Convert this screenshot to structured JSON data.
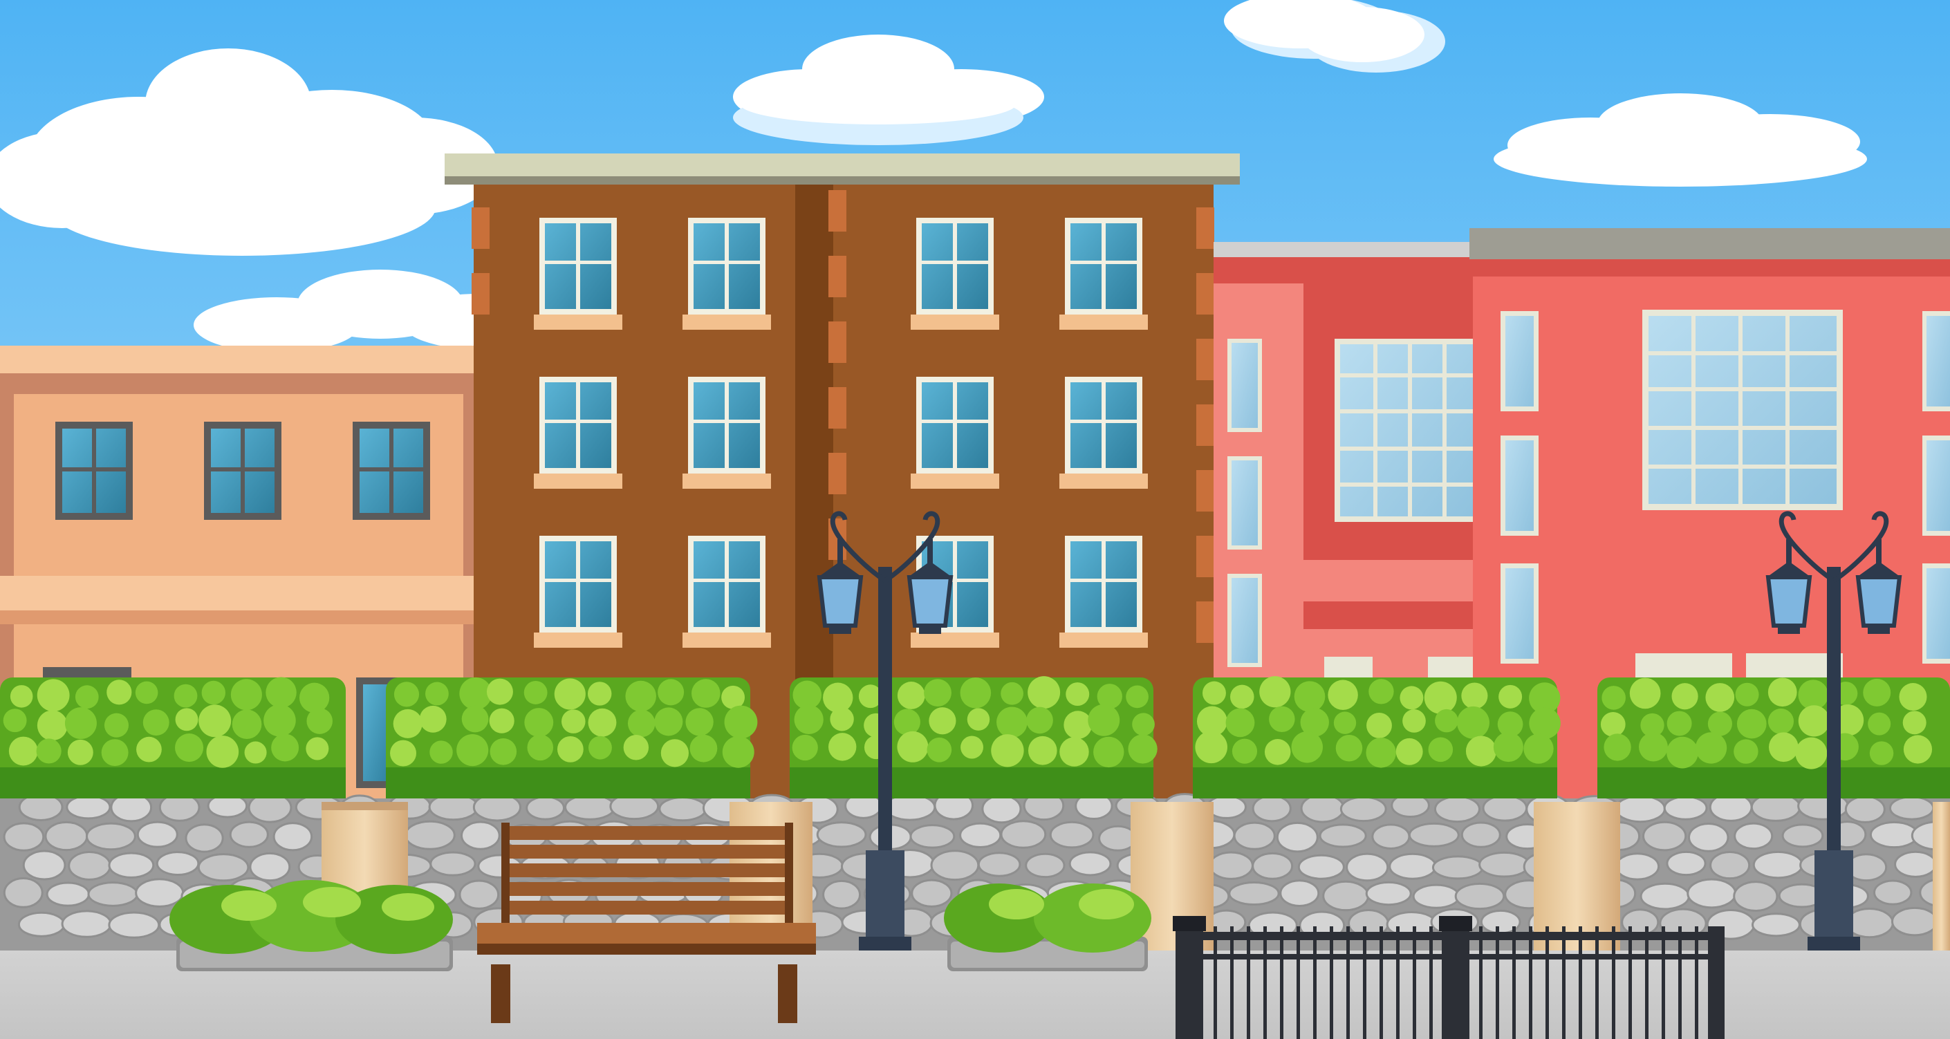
{
  "scene": {
    "description_tag": "",
    "colors": {
      "sky_top": "#4fb3f4",
      "sky_bottom": "#b9e4fb",
      "cloud": "#ffffff",
      "cloud_shade": "#d8efff",
      "tan_building": "#f1b183",
      "tan_building_trim": "#f7c79d",
      "tan_building_side": "#c98566",
      "brown_building": "#995826",
      "brown_building_dark": "#7a4217",
      "brown_building_quoin": "#c9703a",
      "roof_cap": "#d4d6b8",
      "roof_cap_dark": "#8e8d79",
      "window_glass": "#4aa4c6",
      "window_glass_dark": "#2e7d9b",
      "window_frame": "#f2f0e2",
      "sill": "#f3c08e",
      "red_building": "#f16b64",
      "red_building_dark": "#d9504a",
      "red_building_light": "#f3867d",
      "pink_glass": "#a9d2e8",
      "hedge": "#6dba2a",
      "hedge_dark": "#3f8f19",
      "hedge_light": "#a4dc4a",
      "stone_wall": "#c9c9c9",
      "stone_dark": "#8f8f8f",
      "stone_light": "#e8e8e8",
      "wood_pillar": "#ead0a8",
      "wood_pillar_dark": "#c9a074",
      "pavement": "#cfcfcf",
      "pavement_dark": "#bababa",
      "bench_wood": "#9a5a2c",
      "bench_dark": "#6b3a18",
      "lamp_metal": "#2d3a4d",
      "lamp_glass": "#7fb6e0",
      "fence_metal": "#2c2f36"
    },
    "elements": {
      "sky": "sky",
      "clouds": "clouds",
      "tan_building": "tan-building",
      "brown_building": "brown-building",
      "red_building": "red-building",
      "pink_building": "pink-building",
      "hedges": "hedges",
      "stone_wall": "stone-wall",
      "bench": "park-bench",
      "planters": "planters",
      "street_lamps": "street-lamps",
      "fence": "iron-fence",
      "pavement": "pavement"
    }
  }
}
